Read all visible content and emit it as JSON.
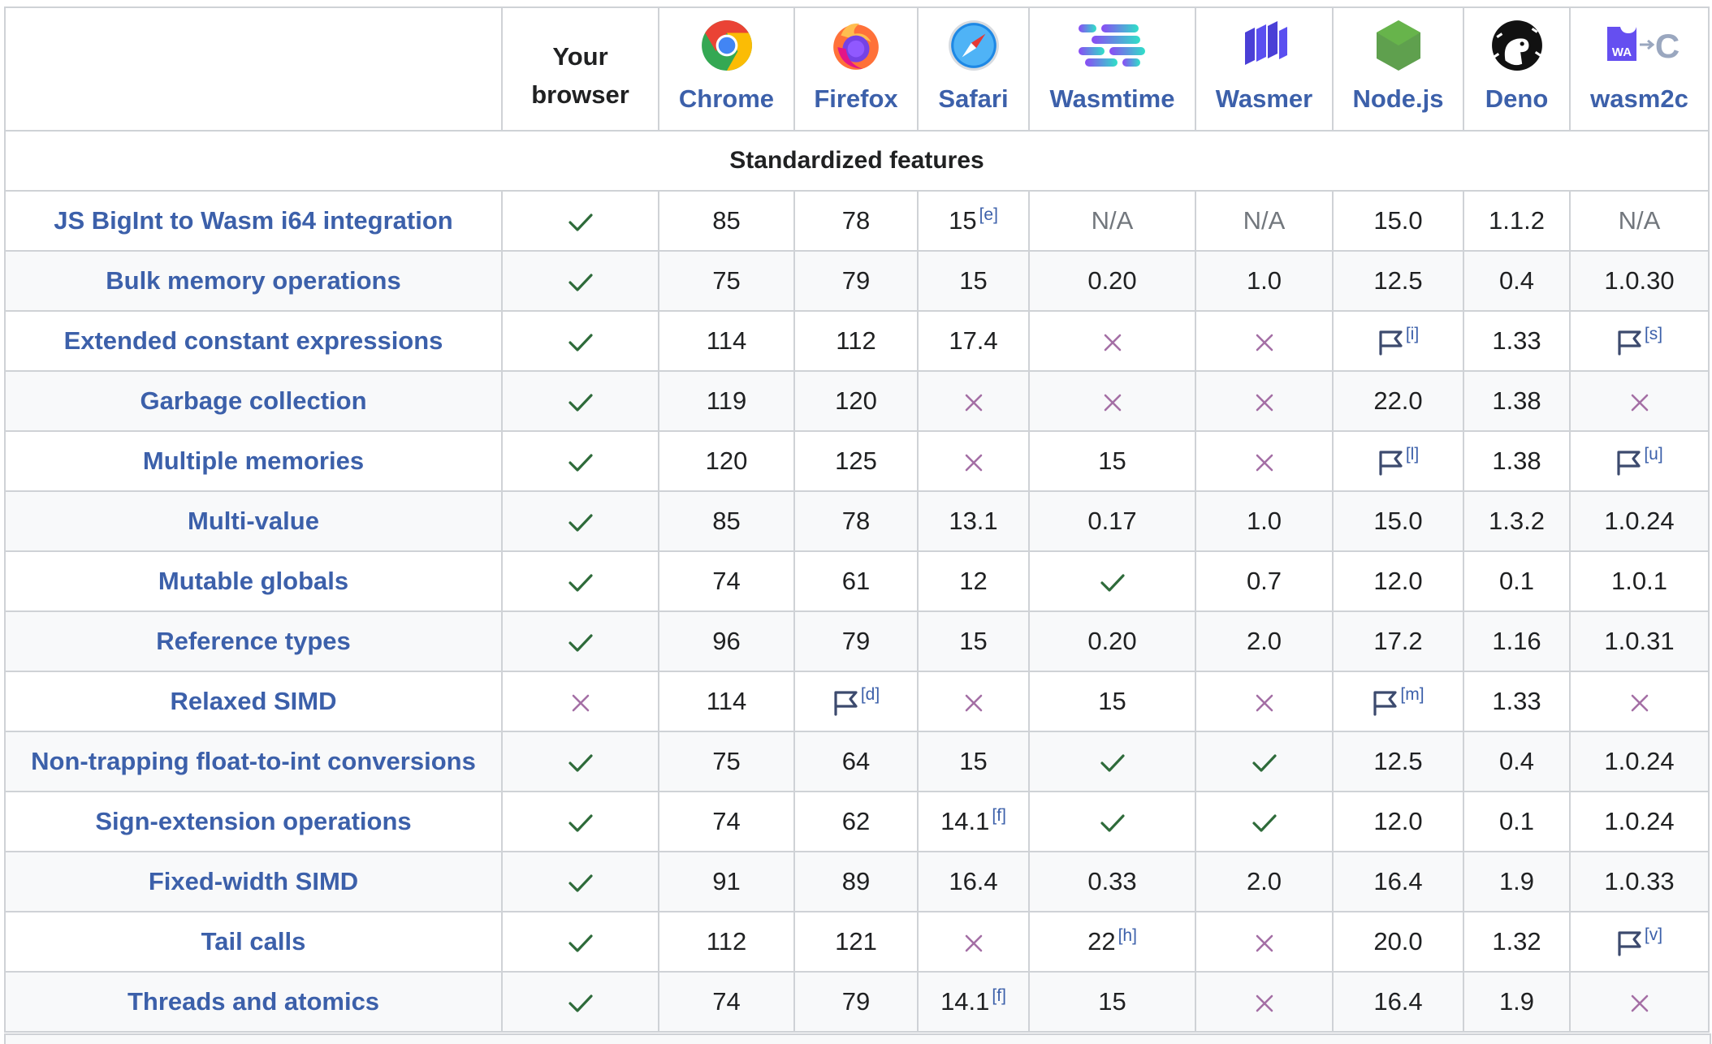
{
  "header": {
    "your_browser_line1": "Your",
    "your_browser_line2": "browser",
    "runtimes": [
      {
        "name": "Chrome",
        "icon": "chrome-icon"
      },
      {
        "name": "Firefox",
        "icon": "firefox-icon"
      },
      {
        "name": "Safari",
        "icon": "safari-icon"
      },
      {
        "name": "Wasmtime",
        "icon": "wasmtime-icon"
      },
      {
        "name": "Wasmer",
        "icon": "wasmer-icon"
      },
      {
        "name": "Node.js",
        "icon": "nodejs-icon"
      },
      {
        "name": "Deno",
        "icon": "deno-icon"
      },
      {
        "name": "wasm2c",
        "icon": "wasm2c-icon",
        "logo_text": "WA"
      }
    ]
  },
  "section_title": "Standardized features",
  "colors": {
    "link": "#3c60aa",
    "check": "#2e6b3a",
    "cross": "#a46fa5",
    "flag": "#3c4a6e",
    "na": "#72777d"
  },
  "rows": [
    {
      "feature": "JS BigInt to Wasm i64 integration",
      "cells": [
        {
          "t": "check"
        },
        {
          "t": "text",
          "v": "85"
        },
        {
          "t": "text",
          "v": "78"
        },
        {
          "t": "text",
          "v": "15",
          "n": "[e]"
        },
        {
          "t": "na",
          "v": "N/A"
        },
        {
          "t": "na",
          "v": "N/A"
        },
        {
          "t": "text",
          "v": "15.0"
        },
        {
          "t": "text",
          "v": "1.1.2"
        },
        {
          "t": "na",
          "v": "N/A"
        }
      ]
    },
    {
      "feature": "Bulk memory operations",
      "cells": [
        {
          "t": "check"
        },
        {
          "t": "text",
          "v": "75"
        },
        {
          "t": "text",
          "v": "79"
        },
        {
          "t": "text",
          "v": "15"
        },
        {
          "t": "text",
          "v": "0.20"
        },
        {
          "t": "text",
          "v": "1.0"
        },
        {
          "t": "text",
          "v": "12.5"
        },
        {
          "t": "text",
          "v": "0.4"
        },
        {
          "t": "text",
          "v": "1.0.30"
        }
      ]
    },
    {
      "feature": "Extended constant expressions",
      "cells": [
        {
          "t": "check"
        },
        {
          "t": "text",
          "v": "114"
        },
        {
          "t": "text",
          "v": "112"
        },
        {
          "t": "text",
          "v": "17.4"
        },
        {
          "t": "cross"
        },
        {
          "t": "cross"
        },
        {
          "t": "flag",
          "n": "[i]"
        },
        {
          "t": "text",
          "v": "1.33"
        },
        {
          "t": "flag",
          "n": "[s]"
        }
      ]
    },
    {
      "feature": "Garbage collection",
      "cells": [
        {
          "t": "check"
        },
        {
          "t": "text",
          "v": "119"
        },
        {
          "t": "text",
          "v": "120"
        },
        {
          "t": "cross"
        },
        {
          "t": "cross"
        },
        {
          "t": "cross"
        },
        {
          "t": "text",
          "v": "22.0"
        },
        {
          "t": "text",
          "v": "1.38"
        },
        {
          "t": "cross"
        }
      ]
    },
    {
      "feature": "Multiple memories",
      "cells": [
        {
          "t": "check"
        },
        {
          "t": "text",
          "v": "120"
        },
        {
          "t": "text",
          "v": "125"
        },
        {
          "t": "cross"
        },
        {
          "t": "text",
          "v": "15"
        },
        {
          "t": "cross"
        },
        {
          "t": "flag",
          "n": "[l]"
        },
        {
          "t": "text",
          "v": "1.38"
        },
        {
          "t": "flag",
          "n": "[u]"
        }
      ]
    },
    {
      "feature": "Multi-value",
      "cells": [
        {
          "t": "check"
        },
        {
          "t": "text",
          "v": "85"
        },
        {
          "t": "text",
          "v": "78"
        },
        {
          "t": "text",
          "v": "13.1"
        },
        {
          "t": "text",
          "v": "0.17"
        },
        {
          "t": "text",
          "v": "1.0"
        },
        {
          "t": "text",
          "v": "15.0"
        },
        {
          "t": "text",
          "v": "1.3.2"
        },
        {
          "t": "text",
          "v": "1.0.24"
        }
      ]
    },
    {
      "feature": "Mutable globals",
      "cells": [
        {
          "t": "check"
        },
        {
          "t": "text",
          "v": "74"
        },
        {
          "t": "text",
          "v": "61"
        },
        {
          "t": "text",
          "v": "12"
        },
        {
          "t": "check"
        },
        {
          "t": "text",
          "v": "0.7"
        },
        {
          "t": "text",
          "v": "12.0"
        },
        {
          "t": "text",
          "v": "0.1"
        },
        {
          "t": "text",
          "v": "1.0.1"
        }
      ]
    },
    {
      "feature": "Reference types",
      "cells": [
        {
          "t": "check"
        },
        {
          "t": "text",
          "v": "96"
        },
        {
          "t": "text",
          "v": "79"
        },
        {
          "t": "text",
          "v": "15"
        },
        {
          "t": "text",
          "v": "0.20"
        },
        {
          "t": "text",
          "v": "2.0"
        },
        {
          "t": "text",
          "v": "17.2"
        },
        {
          "t": "text",
          "v": "1.16"
        },
        {
          "t": "text",
          "v": "1.0.31"
        }
      ]
    },
    {
      "feature": "Relaxed SIMD",
      "cells": [
        {
          "t": "cross"
        },
        {
          "t": "text",
          "v": "114"
        },
        {
          "t": "flag",
          "n": "[d]"
        },
        {
          "t": "cross"
        },
        {
          "t": "text",
          "v": "15"
        },
        {
          "t": "cross"
        },
        {
          "t": "flag",
          "n": "[m]"
        },
        {
          "t": "text",
          "v": "1.33"
        },
        {
          "t": "cross"
        }
      ]
    },
    {
      "feature": "Non-trapping float-to-int conversions",
      "cells": [
        {
          "t": "check"
        },
        {
          "t": "text",
          "v": "75"
        },
        {
          "t": "text",
          "v": "64"
        },
        {
          "t": "text",
          "v": "15"
        },
        {
          "t": "check"
        },
        {
          "t": "check"
        },
        {
          "t": "text",
          "v": "12.5"
        },
        {
          "t": "text",
          "v": "0.4"
        },
        {
          "t": "text",
          "v": "1.0.24"
        }
      ]
    },
    {
      "feature": "Sign-extension operations",
      "cells": [
        {
          "t": "check"
        },
        {
          "t": "text",
          "v": "74"
        },
        {
          "t": "text",
          "v": "62"
        },
        {
          "t": "text",
          "v": "14.1",
          "n": "[f]"
        },
        {
          "t": "check"
        },
        {
          "t": "check"
        },
        {
          "t": "text",
          "v": "12.0"
        },
        {
          "t": "text",
          "v": "0.1"
        },
        {
          "t": "text",
          "v": "1.0.24"
        }
      ]
    },
    {
      "feature": "Fixed-width SIMD",
      "cells": [
        {
          "t": "check"
        },
        {
          "t": "text",
          "v": "91"
        },
        {
          "t": "text",
          "v": "89"
        },
        {
          "t": "text",
          "v": "16.4"
        },
        {
          "t": "text",
          "v": "0.33"
        },
        {
          "t": "text",
          "v": "2.0"
        },
        {
          "t": "text",
          "v": "16.4"
        },
        {
          "t": "text",
          "v": "1.9"
        },
        {
          "t": "text",
          "v": "1.0.33"
        }
      ]
    },
    {
      "feature": "Tail calls",
      "cells": [
        {
          "t": "check"
        },
        {
          "t": "text",
          "v": "112"
        },
        {
          "t": "text",
          "v": "121"
        },
        {
          "t": "cross"
        },
        {
          "t": "text",
          "v": "22",
          "n": "[h]"
        },
        {
          "t": "cross"
        },
        {
          "t": "text",
          "v": "20.0"
        },
        {
          "t": "text",
          "v": "1.32"
        },
        {
          "t": "flag",
          "n": "[v]"
        }
      ]
    },
    {
      "feature": "Threads and atomics",
      "cells": [
        {
          "t": "check"
        },
        {
          "t": "text",
          "v": "74"
        },
        {
          "t": "text",
          "v": "79"
        },
        {
          "t": "text",
          "v": "14.1",
          "n": "[f]"
        },
        {
          "t": "text",
          "v": "15"
        },
        {
          "t": "cross"
        },
        {
          "t": "text",
          "v": "16.4"
        },
        {
          "t": "text",
          "v": "1.9"
        },
        {
          "t": "cross"
        }
      ]
    }
  ]
}
